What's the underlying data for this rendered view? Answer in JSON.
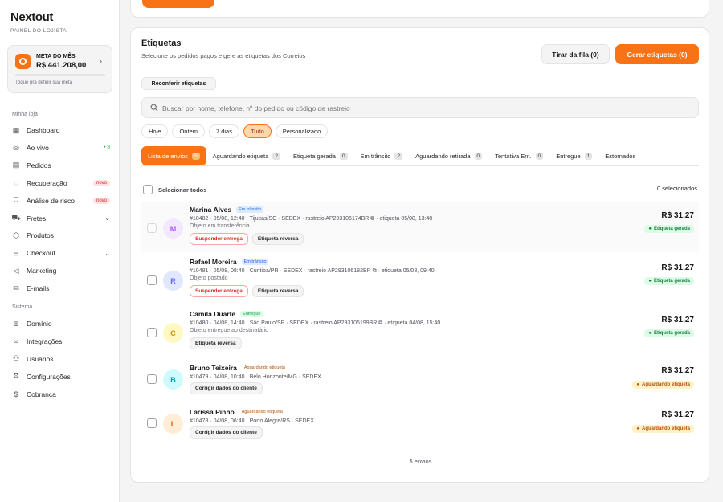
{
  "brand": {
    "name": "Nextout",
    "subtitle": "PAINEL DO LOJISTA"
  },
  "goal": {
    "title": "META DO MÊS",
    "value": "R$ 441.208,00",
    "hint": "Toque pra definir sua meta"
  },
  "sidebar": {
    "section_store": "Minha loja",
    "section_system": "Sistema",
    "items": [
      {
        "label": "Dashboard",
        "icon": "grid-icon",
        "glyph": "▦"
      },
      {
        "label": "Ao vivo",
        "icon": "live-icon",
        "glyph": "◎",
        "extra": "• 8"
      },
      {
        "label": "Pedidos",
        "icon": "orders-icon",
        "glyph": "▤"
      },
      {
        "label": "Recuperação",
        "icon": "chat-icon",
        "glyph": "◌",
        "badge": "novo"
      },
      {
        "label": "Análise de risco",
        "icon": "shield-icon",
        "glyph": "⛉",
        "badge": "novo"
      },
      {
        "label": "Fretes",
        "icon": "truck-icon",
        "glyph": "⛟",
        "chevron": "⌄"
      },
      {
        "label": "Produtos",
        "icon": "box-icon",
        "glyph": "⬡"
      },
      {
        "label": "Checkout",
        "icon": "cart-icon",
        "glyph": "⊟",
        "chevron": "⌄"
      },
      {
        "label": "Marketing",
        "icon": "megaphone-icon",
        "glyph": "◁"
      },
      {
        "label": "E-mails",
        "icon": "mail-icon",
        "glyph": "✉"
      }
    ],
    "system_items": [
      {
        "label": "Domínio",
        "icon": "globe-icon",
        "glyph": "⊕"
      },
      {
        "label": "Integrações",
        "icon": "link-icon",
        "glyph": "∞"
      },
      {
        "label": "Usuários",
        "icon": "users-icon",
        "glyph": "⚇"
      },
      {
        "label": "Configurações",
        "icon": "gear-icon",
        "glyph": "⚙"
      },
      {
        "label": "Cobrança",
        "icon": "dollar-icon",
        "glyph": "$"
      }
    ]
  },
  "labels_panel": {
    "title": "Etiquetas",
    "subtitle": "Selecione os pedidos pagos e gere as etiquetas dos Correios",
    "queue_button": "Tirar da fila (0)",
    "generate_button": "Gerar etiquetas (0)",
    "recheck_button": "Reconferir etiquetas",
    "search_placeholder": "Buscar por nome, telefone, nº do pedido ou código de rastreio",
    "date_filters": [
      "Hoje",
      "Ontem",
      "7 dias",
      "Tudo",
      "Personalizado"
    ],
    "active_date_filter": "Tudo",
    "tabs": [
      {
        "label": "Lista de envios",
        "count": "5"
      },
      {
        "label": "Aguardando etiqueta",
        "count": "2"
      },
      {
        "label": "Etiqueta gerada",
        "count": "0"
      },
      {
        "label": "Em trânsito",
        "count": "2"
      },
      {
        "label": "Aguardando retirada",
        "count": "0"
      },
      {
        "label": "Tentativa Ent.",
        "count": "0"
      },
      {
        "label": "Entregue",
        "count": "1"
      },
      {
        "label": "Estornados",
        "count": ""
      }
    ],
    "select_all": "Selecionar todos",
    "selected_count": "0 selecionados",
    "footer": "5 envios"
  },
  "shipments": [
    {
      "initial": "M",
      "name": "Marina Alves",
      "status": "Em trânsito",
      "status_style": "blue",
      "meta": "#10482 · 05/08, 12:40 · Tijucas/SC · SEDEX · rastreio  AP293106174BR ⧉ · etiqueta 05/08, 13:40",
      "note": "Objeto em transferência",
      "actions": [
        "Suspender entrega",
        "Etiqueta reversa"
      ],
      "price": "R$ 31,27",
      "pill": "Etiqueta gerada",
      "pill_style": "green",
      "avatar_bg": "#f3e8ff",
      "avatar_fg": "#a855f7",
      "faded": true
    },
    {
      "initial": "R",
      "name": "Rafael Moreira",
      "status": "Em trânsito",
      "status_style": "blue",
      "meta": "#10481 · 05/08, 08:40 · Curitiba/PR · SEDEX · rastreio  AP293106182BR ⧉ · etiqueta 05/08, 09:40",
      "note": "Objeto postado",
      "actions": [
        "Suspender entrega",
        "Etiqueta reversa"
      ],
      "price": "R$ 31,27",
      "pill": "Etiqueta gerada",
      "pill_style": "green",
      "avatar_bg": "#e0e7ff",
      "avatar_fg": "#6366f1",
      "faded": false
    },
    {
      "initial": "C",
      "name": "Camila Duarte",
      "status": "Entregue",
      "status_style": "green",
      "meta": "#10480 · 04/08, 14:40 · São Paulo/SP · SEDEX · rastreio  AP293106199BR ⧉ · etiqueta 04/08, 15:40",
      "note": "Objeto entregue ao destinatário",
      "actions": [
        "Etiqueta reversa"
      ],
      "price": "R$ 31,27",
      "pill": "Etiqueta gerada",
      "pill_style": "green",
      "avatar_bg": "#fef9c3",
      "avatar_fg": "#ca8a04",
      "faded": false
    },
    {
      "initial": "B",
      "name": "Bruno Teixeira",
      "status": "Aguardando etiqueta",
      "status_style": "amber",
      "meta": "#10479 · 04/08, 10:40 · Belo Horizonte/MG · SEDEX",
      "note": "",
      "actions": [
        "Corrigir dados do cliente"
      ],
      "price": "R$ 31,27",
      "pill": "Aguardando etiqueta",
      "pill_style": "amber",
      "avatar_bg": "#cffafe",
      "avatar_fg": "#0891b2",
      "faded": false
    },
    {
      "initial": "L",
      "name": "Larissa Pinho",
      "status": "Aguardando etiqueta",
      "status_style": "amber",
      "meta": "#10478 · 04/08, 06:40 · Porto Alegre/RS · SEDEX",
      "note": "",
      "actions": [
        "Corrigir dados do cliente"
      ],
      "price": "R$ 31,27",
      "pill": "Aguardando etiqueta",
      "pill_style": "amber",
      "avatar_bg": "#ffedd5",
      "avatar_fg": "#ea580c",
      "faded": false
    }
  ]
}
